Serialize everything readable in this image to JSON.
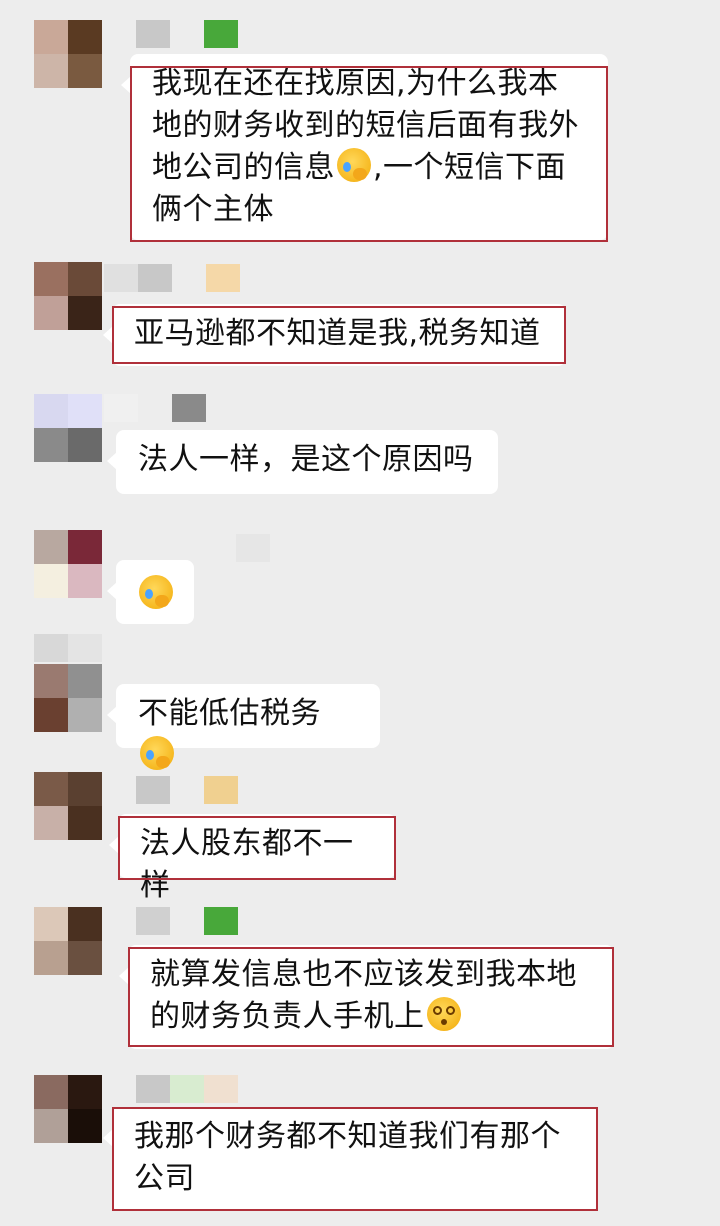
{
  "chat": {
    "messages": [
      {
        "text": "我现在还在找原因,为什么我本地的财务收到的短信后面有我外地公司的信息",
        "emoji": "face-palm-crying-emoji",
        "text_after": ",一个短信下面俩个主体",
        "highlighted": true
      },
      {
        "text": "亚马逊都不知道是我,税务知道",
        "highlighted": true
      },
      {
        "text": "法人一样，是这个原因吗",
        "highlighted": false
      },
      {
        "text": "",
        "emoji": "face-palm-crying-emoji",
        "highlighted": false
      },
      {
        "text": "不能低估税务",
        "emoji": "face-palm-crying-emoji",
        "highlighted": false
      },
      {
        "text": "法人股东都不一样",
        "highlighted": true
      },
      {
        "text": "就算发信息也不应该发到我本地的财务负责人手机上",
        "emoji": "dizzy-face-emoji",
        "highlighted": true
      },
      {
        "text": "我那个财务都不知道我们有那个公司",
        "highlighted": true
      }
    ]
  },
  "colors": {
    "background": "#ededed",
    "bubble": "#ffffff",
    "highlight_border": "#b0303a"
  }
}
